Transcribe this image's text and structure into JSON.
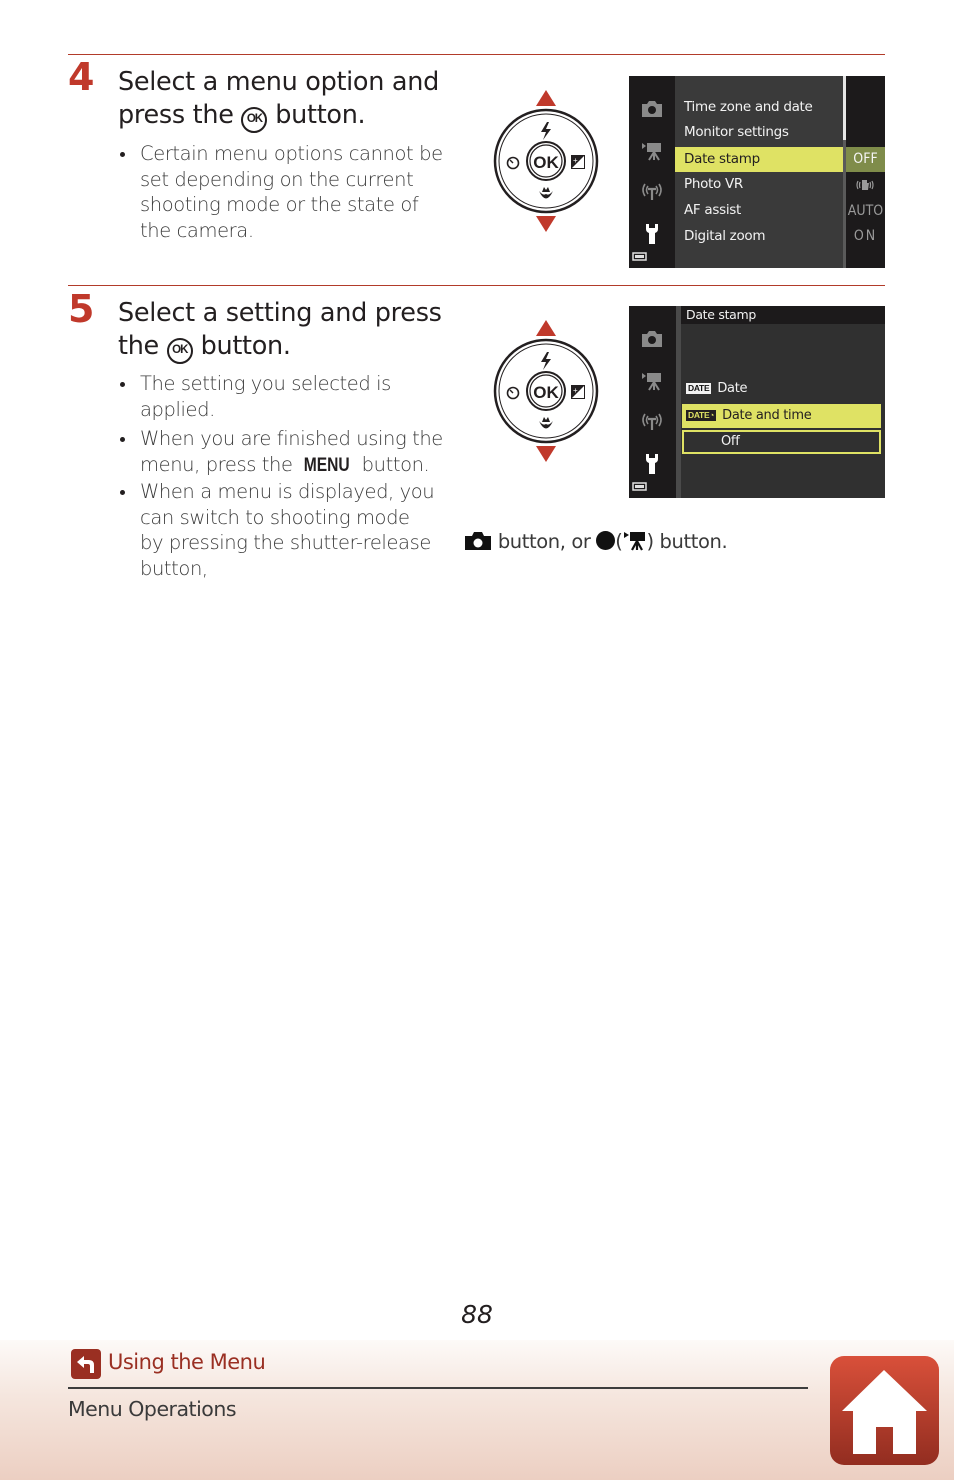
{
  "colors": {
    "accent_red": "#c0392b",
    "screen_highlight": "#dfe264",
    "screen_bg": "#1c1a1b",
    "screen_panel": "#3a3a3a",
    "crumb_red": "#9a2f22"
  },
  "step4": {
    "number": "4",
    "title_line1": "Select a menu option and",
    "title_pre": "press the",
    "title_post": "button.",
    "ok_icon_label": "OK",
    "bullets": [
      "Certain menu options cannot be set depending on the current shooting mode or the state of the camera."
    ],
    "selector": {
      "center_label": "OK"
    },
    "screen": {
      "sidebar_icons": [
        "camera-icon",
        "movie-icon",
        "wireless-icon",
        "wrench-icon",
        "battery-icon"
      ],
      "items": [
        {
          "label": "Time zone and date",
          "value": ""
        },
        {
          "label": "Monitor settings",
          "value": ""
        },
        {
          "label": "Date stamp",
          "value": "OFF",
          "selected": true
        },
        {
          "label": "Photo VR",
          "value": "vr-icon"
        },
        {
          "label": "AF assist",
          "value": "AUTO"
        },
        {
          "label": "Digital zoom",
          "value": "ON"
        }
      ]
    }
  },
  "step5": {
    "number": "5",
    "title_line1": "Select a setting and press",
    "title_pre": "the",
    "title_post": "button.",
    "ok_icon_label": "OK",
    "bullets": {
      "b1": "The setting you selected is applied.",
      "b2_pre": "When you are finished using the menu, press the",
      "b2_menu": "MENU",
      "b2_post": "button.",
      "b3_pre": "When a menu is displayed, you can switch to shooting mode by pressing the shutter-release button,",
      "b3_mid": "button, or",
      "b3_paren_open": "(",
      "b3_post": ") button."
    },
    "selector": {
      "center_label": "OK"
    },
    "screen": {
      "header": "Date stamp",
      "options": [
        {
          "badge": "DATE",
          "label": "Date",
          "state": "normal"
        },
        {
          "badge": "DATE◔",
          "label": "Date and time",
          "state": "highlighted"
        },
        {
          "badge": "",
          "label": "Off",
          "state": "current"
        }
      ]
    }
  },
  "page_number": "88",
  "footer": {
    "section_link": "Using the Menu",
    "subsection": "Menu Operations",
    "home_label": "home"
  }
}
